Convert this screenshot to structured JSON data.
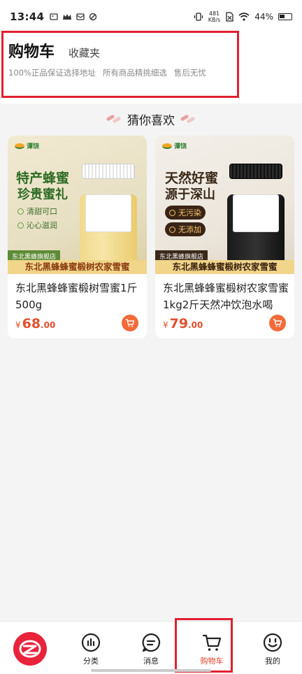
{
  "status_bar": {
    "time": "13:44",
    "left_icons": [
      "image-icon",
      "crown-icon",
      "mail-icon",
      "sync-icon"
    ],
    "net_speed": "481",
    "net_unit": "KB/s",
    "battery": "44%"
  },
  "header": {
    "title": "购物车",
    "fav_tab": "收藏夹",
    "guarantees": [
      "100%正品保证选择地址",
      "所有商品精挑细选",
      "售后无忧"
    ]
  },
  "recommend": {
    "title": "猜你喜欢"
  },
  "products": [
    {
      "image": {
        "brand": "谭饶",
        "headline1": "特产蜂蜜",
        "headline2": "珍贵蜜礼",
        "tags": [
          "清甜可口",
          "沁心滋润"
        ],
        "shop_tag": "东北黑蜂旗舰店",
        "promo": "东北黑蜂蜂蜜椴树农家雪蜜"
      },
      "name": "东北黑蜂蜂蜜椴树雪蜜1斤500g",
      "price_symbol": "¥",
      "price_int": "68",
      "price_dec": ".00"
    },
    {
      "image": {
        "brand": "谭饶",
        "headline1": "天然好蜜",
        "headline2": "源于深山",
        "tags": [
          "无污染",
          "无添加"
        ],
        "shop_tag": "东北黑蜂旗舰店",
        "promo": "东北黑蜂蜂蜜椴树农家雪蜜"
      },
      "name": "东北黑蜂蜂蜜椴树农家雪蜜1kg2斤天然冲饮泡水喝",
      "price_symbol": "¥",
      "price_int": "79",
      "price_dec": ".00"
    }
  ],
  "bottom_nav": {
    "items": [
      {
        "label": "分类",
        "icon": "category-icon"
      },
      {
        "label": "消息",
        "icon": "message-icon"
      },
      {
        "label": "购物车",
        "icon": "cart-icon",
        "active": true
      },
      {
        "label": "我的",
        "icon": "profile-icon"
      }
    ]
  },
  "colors": {
    "accent": "#e0402a",
    "price": "#e2502c",
    "highlight_box": "#e02030"
  }
}
